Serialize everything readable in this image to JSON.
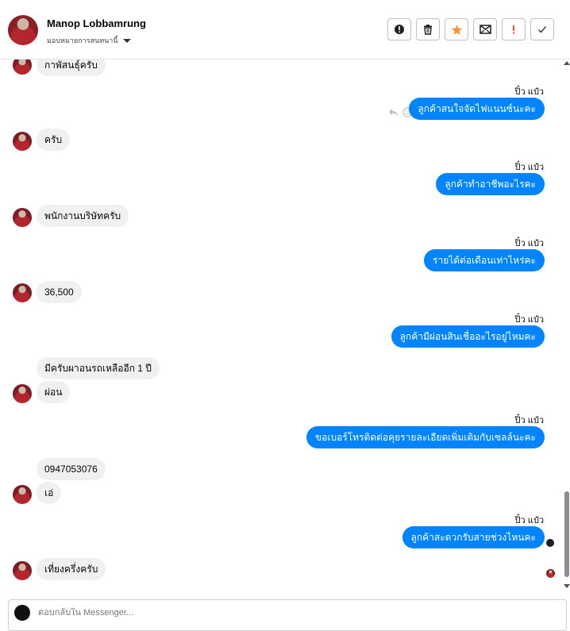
{
  "header": {
    "name": "Manop Lobbamrung",
    "assign_label": "มอบหมายการสนทนานี้",
    "buttons": [
      "alert-circle-icon",
      "trash-icon",
      "star-icon",
      "mail-icon",
      "flag-icon",
      "check-icon"
    ],
    "star_color": "#f7923a"
  },
  "messages": [
    {
      "dir": "in",
      "text": "กาพัสนธุ์ครับ"
    },
    {
      "dir": "out",
      "sender": "ปิ๋ว แป๋ว",
      "text": "ลูกค้าสนใจจัดไฟแนนซ์นะคะ"
    },
    {
      "dir": "in",
      "text": "ครับ"
    },
    {
      "dir": "out",
      "sender": "ปิ๋ว แป๋ว",
      "text": "ลูกค้าทำอาชีพอะไรคะ"
    },
    {
      "dir": "in",
      "text": "พนักงานบริษัทครับ"
    },
    {
      "dir": "out",
      "sender": "ปิ๋ว แป๋ว",
      "text": "รายได้ต่อเดือนเท่าไหร่คะ"
    },
    {
      "dir": "in",
      "text": "36,500"
    },
    {
      "dir": "out",
      "sender": "ปิ๋ว แป๋ว",
      "text": "ลูกค้ามีผ่อนสินเชื่ออะไรอยู่ไหมคะ"
    },
    {
      "dir": "in",
      "text": "มีครับผาอนรถเหลืออีก 1 ปี"
    },
    {
      "dir": "in",
      "text": "ผ่อน"
    },
    {
      "dir": "out",
      "sender": "ปิ๋ว แป๋ว",
      "text": "ขอเบอร์โทรติดต่อคุยรายละเอียดเพิ่มเติมกับเซลล์นะคะ"
    },
    {
      "dir": "in",
      "text": "0947053076"
    },
    {
      "dir": "in",
      "text": "เอ่"
    },
    {
      "dir": "out",
      "sender": "ปิ๋ว แป๋ว",
      "text": "ลูกค้าสะดวกรับสายช่วงไหนคะ"
    },
    {
      "dir": "in",
      "text": "เที่ยงครึ่งครับ"
    }
  ],
  "composer": {
    "placeholder": "ตอบกลับใน Messenger..."
  },
  "colors": {
    "outgoing_bubble": "#0084ff",
    "incoming_bubble": "#f0f0f0"
  }
}
